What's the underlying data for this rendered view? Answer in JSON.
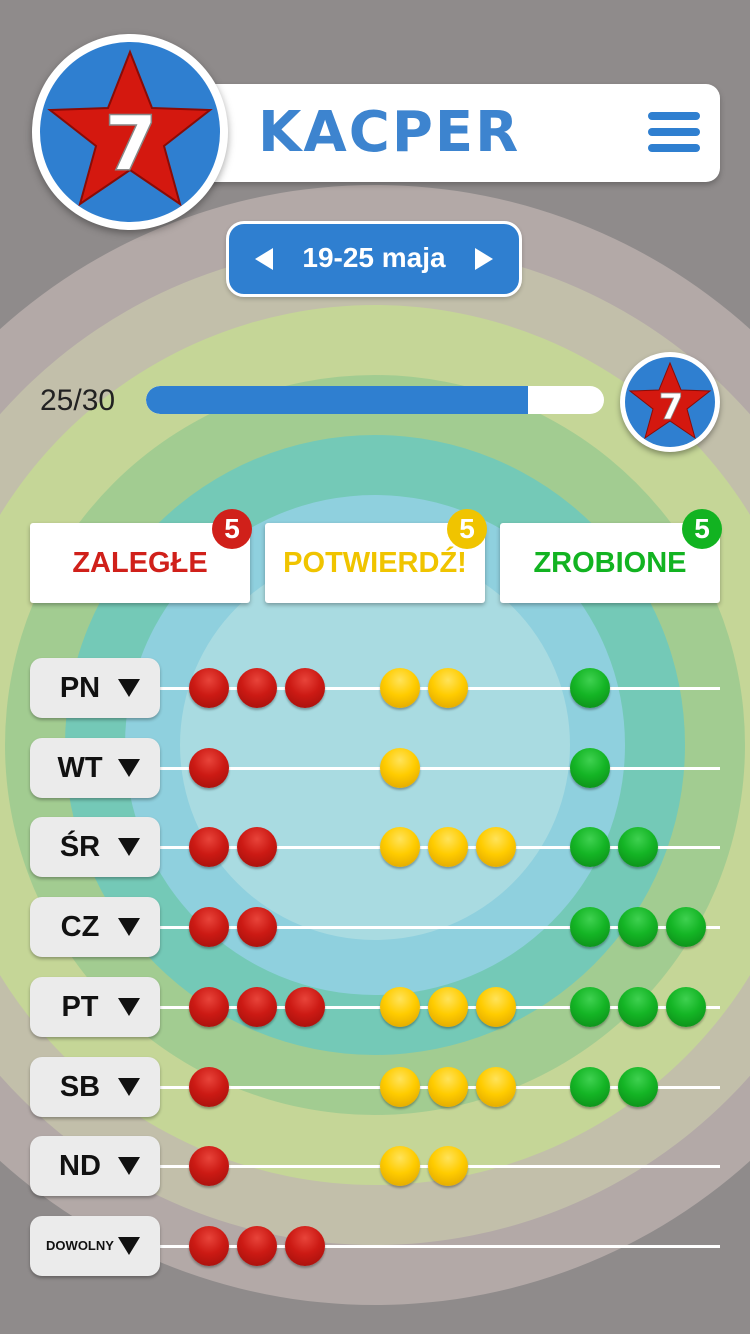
{
  "header": {
    "name": "KACPER",
    "badge_number": "7"
  },
  "week": {
    "label": "19-25 maja"
  },
  "progress": {
    "text": "25/30",
    "done": 25,
    "total": 30,
    "badge_number": "7"
  },
  "tabs": [
    {
      "label": "ZALEGŁE",
      "count": "5",
      "color": "#d0201a"
    },
    {
      "label": "POTWIERDŹ!",
      "count": "5",
      "color": "#f0c400"
    },
    {
      "label": "ZROBIONE",
      "count": "5",
      "color": "#12b321"
    }
  ],
  "colors": {
    "accent": "#2f7fd0",
    "star": "#d4180f"
  },
  "days": [
    {
      "label": "PN",
      "red": 3,
      "yellow": 2,
      "green": 1
    },
    {
      "label": "WT",
      "red": 1,
      "yellow": 1,
      "green": 1
    },
    {
      "label": "ŚR",
      "red": 2,
      "yellow": 3,
      "green": 2
    },
    {
      "label": "CZ",
      "red": 2,
      "yellow": 0,
      "green": 3
    },
    {
      "label": "PT",
      "red": 3,
      "yellow": 3,
      "green": 3
    },
    {
      "label": "SB",
      "red": 1,
      "yellow": 3,
      "green": 2
    },
    {
      "label": "ND",
      "red": 1,
      "yellow": 2,
      "green": 0
    },
    {
      "label": "DOWOLNY",
      "red": 3,
      "yellow": 0,
      "green": 0
    }
  ]
}
